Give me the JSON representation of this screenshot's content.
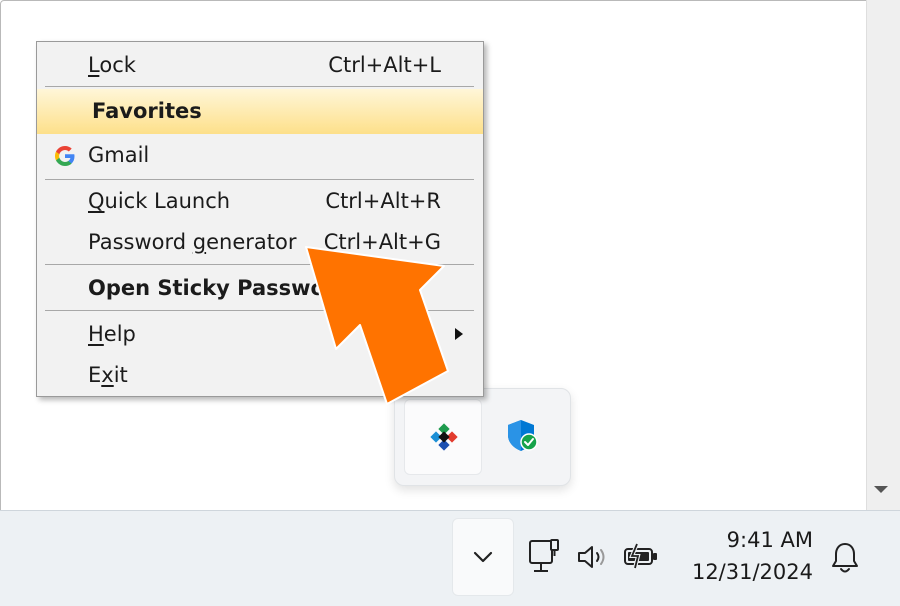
{
  "menu": {
    "items": [
      {
        "label": "Lock",
        "mnemonic": "L",
        "shortcut": "Ctrl+Alt+L"
      },
      {
        "label": "Favorites"
      },
      {
        "label": "Gmail"
      },
      {
        "label": "Quick Launch",
        "mnemonic": "Q",
        "shortcut": "Ctrl+Alt+R"
      },
      {
        "label": "Password generator",
        "mnemonic": "g",
        "shortcut": "Ctrl+Alt+G"
      },
      {
        "label": "Open Sticky Password"
      },
      {
        "label": "Help",
        "mnemonic": "H"
      },
      {
        "label": "Exit",
        "mnemonic": "x"
      }
    ]
  },
  "taskbar": {
    "time": "9:41 AM",
    "date": "12/31/2024"
  },
  "icons": {
    "google": "google-g-icon",
    "sticky_password": "sticky-password-icon",
    "security": "windows-security-icon",
    "network": "network-icon",
    "volume": "volume-icon",
    "battery": "battery-charging-icon",
    "notifications": "bell-icon",
    "chevron": "chevron-up-icon"
  },
  "colors": {
    "accent_arrow": "#ff7300",
    "favorites_highlight": "#fde08a",
    "security_blue": "#0078d4",
    "security_check": "#16a34a"
  }
}
